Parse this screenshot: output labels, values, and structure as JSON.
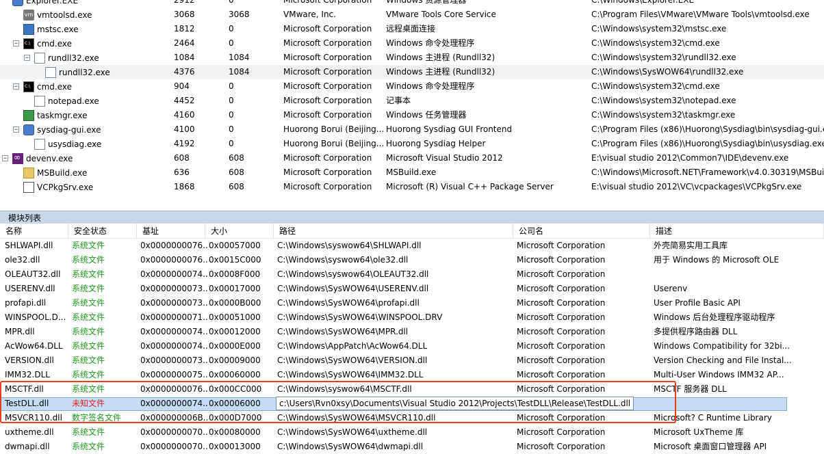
{
  "processes": [
    {
      "indent": 0,
      "toggle": "",
      "icon": "hr",
      "name": "Explorer.EXE",
      "pid": "2912",
      "ppid": "0",
      "company": "Microsoft Corporation",
      "desc": "Windows 资源管理器",
      "path": "C:\\Windows\\Explorer.EXE",
      "icon_name": "explorer-icon"
    },
    {
      "indent": 1,
      "toggle": "",
      "icon": "vm",
      "name": "vmtoolsd.exe",
      "pid": "3068",
      "ppid": "3068",
      "company": "VMware, Inc.",
      "desc": "VMware Tools Core Service",
      "path": "C:\\Program Files\\VMware\\VMware Tools\\vmtoolsd.exe",
      "icon_name": "vmware-icon"
    },
    {
      "indent": 1,
      "toggle": "",
      "icon": "rdp",
      "name": "mstsc.exe",
      "pid": "1812",
      "ppid": "0",
      "company": "Microsoft Corporation",
      "desc": "远程桌面连接",
      "path": "C:\\Windows\\system32\\mstsc.exe",
      "icon_name": "remote-desktop-icon"
    },
    {
      "indent": 1,
      "toggle": "⊟",
      "icon": "cmd",
      "name": "cmd.exe",
      "pid": "2464",
      "ppid": "0",
      "company": "Microsoft Corporation",
      "desc": "Windows 命令处理程序",
      "path": "C:\\Windows\\system32\\cmd.exe",
      "icon_name": "cmd-icon"
    },
    {
      "indent": 2,
      "toggle": "⊟",
      "icon": "doc",
      "name": "rundll32.exe",
      "pid": "1084",
      "ppid": "1084",
      "company": "Microsoft Corporation",
      "desc": "Windows 主进程 (Rundll32)",
      "path": "C:\\Windows\\system32\\rundll32.exe",
      "icon_name": "document-icon"
    },
    {
      "indent": 3,
      "toggle": "",
      "icon": "doc",
      "name": "rundll32.exe",
      "pid": "4376",
      "ppid": "1084",
      "company": "Microsoft Corporation",
      "desc": "Windows 主进程 (Rundll32)",
      "path": "C:\\Windows\\SysWOW64\\rundll32.exe",
      "icon_name": "document-icon",
      "selected": true
    },
    {
      "indent": 1,
      "toggle": "⊟",
      "icon": "cmd",
      "name": "cmd.exe",
      "pid": "904",
      "ppid": "0",
      "company": "Microsoft Corporation",
      "desc": "Windows 命令处理程序",
      "path": "C:\\Windows\\system32\\cmd.exe",
      "icon_name": "cmd-icon"
    },
    {
      "indent": 2,
      "toggle": "",
      "icon": "doc",
      "name": "notepad.exe",
      "pid": "4452",
      "ppid": "0",
      "company": "Microsoft Corporation",
      "desc": "记事本",
      "path": "C:\\Windows\\system32\\notepad.exe",
      "icon_name": "notepad-icon"
    },
    {
      "indent": 1,
      "toggle": "",
      "icon": "task",
      "name": "taskmgr.exe",
      "pid": "4160",
      "ppid": "0",
      "company": "Microsoft Corporation",
      "desc": "Windows 任务管理器",
      "path": "C:\\Windows\\system32\\taskmgr.exe",
      "icon_name": "task-manager-icon"
    },
    {
      "indent": 1,
      "toggle": "⊟",
      "icon": "hr",
      "name": "sysdiag-gui.exe",
      "pid": "4100",
      "ppid": "0",
      "company": "Huorong Borui (Beijing...",
      "desc": "Huorong Sysdiag GUI Frontend",
      "path": "C:\\Program Files (x86)\\Huorong\\Sysdiag\\bin\\sysdiag-gui.e",
      "icon_name": "huorong-icon"
    },
    {
      "indent": 2,
      "toggle": "",
      "icon": "doc",
      "name": "usysdiag.exe",
      "pid": "4192",
      "ppid": "0",
      "company": "Huorong Borui (Beijing...",
      "desc": "Huorong Sysdiag Helper",
      "path": "C:\\Program Files (x86)\\Huorong\\Sysdiag\\bin\\usysdiag.exe",
      "icon_name": "document-icon"
    },
    {
      "indent": 0,
      "toggle": "⊟",
      "icon": "vs",
      "name": "devenv.exe",
      "pid": "608",
      "ppid": "608",
      "company": "Microsoft Corporation",
      "desc": "Microsoft Visual Studio 2012",
      "path": "E:\\visual studio 2012\\Common7\\IDE\\devenv.exe",
      "icon_name": "visual-studio-icon"
    },
    {
      "indent": 1,
      "toggle": "",
      "icon": "ms",
      "name": "MSBuild.exe",
      "pid": "636",
      "ppid": "608",
      "company": "Microsoft Corporation",
      "desc": "MSBuild.exe",
      "path": "C:\\Windows\\Microsoft.NET\\Framework\\v4.0.30319\\MSBuil",
      "icon_name": "msbuild-icon"
    },
    {
      "indent": 1,
      "toggle": "",
      "icon": "vc",
      "name": "VCPkgSrv.exe",
      "pid": "1868",
      "ppid": "608",
      "company": "Microsoft Corporation",
      "desc": "Microsoft (R) Visual C++ Package Server",
      "path": "E:\\visual studio 2012\\VC\\vcpackages\\VCPkgSrv.exe",
      "icon_name": "vcpkgsrv-icon"
    }
  ],
  "module_panel": {
    "title": "模块列表",
    "columns": [
      "名称",
      "安全状态",
      "基址",
      "大小",
      "路径",
      "公司名",
      "描述"
    ]
  },
  "modules": [
    {
      "name": "SHLWAPI.dll",
      "status": "系统文件",
      "status_type": "sys",
      "base": "0x0000000076...",
      "size": "0x00057000",
      "path": "C:\\Windows\\syswow64\\SHLWAPI.dll",
      "company": "Microsoft Corporation",
      "desc": "外壳简易实用工具库"
    },
    {
      "name": "ole32.dll",
      "status": "系统文件",
      "status_type": "sys",
      "base": "0x0000000076...",
      "size": "0x0015C000",
      "path": "C:\\Windows\\syswow64\\ole32.dll",
      "company": "Microsoft Corporation",
      "desc": "用于 Windows 的 Microsoft OLE"
    },
    {
      "name": "OLEAUT32.dll",
      "status": "系统文件",
      "status_type": "sys",
      "base": "0x0000000074...",
      "size": "0x0008F000",
      "path": "C:\\Windows\\syswow64\\OLEAUT32.dll",
      "company": "Microsoft Corporation",
      "desc": ""
    },
    {
      "name": "USERENV.dll",
      "status": "系统文件",
      "status_type": "sys",
      "base": "0x0000000073...",
      "size": "0x00017000",
      "path": "C:\\Windows\\SysWOW64\\USERENV.dll",
      "company": "Microsoft Corporation",
      "desc": "Userenv"
    },
    {
      "name": "profapi.dll",
      "status": "系统文件",
      "status_type": "sys",
      "base": "0x0000000073...",
      "size": "0x0000B000",
      "path": "C:\\Windows\\SysWOW64\\profapi.dll",
      "company": "Microsoft Corporation",
      "desc": "User Profile Basic API"
    },
    {
      "name": "WINSPOOL.D...",
      "status": "系统文件",
      "status_type": "sys",
      "base": "0x0000000071...",
      "size": "0x00051000",
      "path": "C:\\Windows\\SysWOW64\\WINSPOOL.DRV",
      "company": "Microsoft Corporation",
      "desc": "Windows 后台处理程序驱动程序"
    },
    {
      "name": "MPR.dll",
      "status": "系统文件",
      "status_type": "sys",
      "base": "0x0000000074...",
      "size": "0x00012000",
      "path": "C:\\Windows\\SysWOW64\\MPR.dll",
      "company": "Microsoft Corporation",
      "desc": "多提供程序路由器 DLL"
    },
    {
      "name": "AcWow64.DLL",
      "status": "系统文件",
      "status_type": "sys",
      "base": "0x0000000074...",
      "size": "0x0000E000",
      "path": "C:\\Windows\\AppPatch\\AcWow64.DLL",
      "company": "Microsoft Corporation",
      "desc": "Windows Compatibility for 32bi..."
    },
    {
      "name": "VERSION.dll",
      "status": "系统文件",
      "status_type": "sys",
      "base": "0x0000000073...",
      "size": "0x00009000",
      "path": "C:\\Windows\\SysWOW64\\VERSION.dll",
      "company": "Microsoft Corporation",
      "desc": "Version Checking and File Instal..."
    },
    {
      "name": "IMM32.DLL",
      "status": "系统文件",
      "status_type": "sys",
      "base": "0x0000000075...",
      "size": "0x00060000",
      "path": "C:\\Windows\\SysWOW64\\IMM32.DLL",
      "company": "Microsoft Corporation",
      "desc": "Multi-User Windows IMM32 AP..."
    },
    {
      "name": "MSCTF.dll",
      "status": "系统文件",
      "status_type": "sys",
      "base": "0x0000000076...",
      "size": "0x000CC000",
      "path": "C:\\Windows\\syswow64\\MSCTF.dll",
      "company": "Microsoft Corporation",
      "desc": "MSCTF 服务器 DLL"
    },
    {
      "name": "TestDLL.dll",
      "status": "未知文件",
      "status_type": "unk",
      "base": "0x0000000074...",
      "size": "0x00006000",
      "path": "c:\\Users\\Rvn0xsy\\Documents\\Visual Studio 2012\\Projects\\TestDLL\\Release\\TestDLL.dll",
      "company": "",
      "desc": "",
      "selected": true
    },
    {
      "name": "MSVCR110.dll",
      "status": "数字签名文件",
      "status_type": "sig",
      "base": "0x000000006B...",
      "size": "0x000D7000",
      "path": "C:\\Windows\\SysWOW64\\MSVCR110.dll",
      "company": "Microsoft Corporation",
      "desc": "Microsoft? C Runtime Library"
    },
    {
      "name": "uxtheme.dll",
      "status": "系统文件",
      "status_type": "sys",
      "base": "0x0000000070...",
      "size": "0x00080000",
      "path": "C:\\Windows\\SysWOW64\\uxtheme.dll",
      "company": "Microsoft Corporation",
      "desc": "Microsoft UxTheme 库"
    },
    {
      "name": "dwmapi.dll",
      "status": "系统文件",
      "status_type": "sys",
      "base": "0x0000000070...",
      "size": "0x00013000",
      "path": "C:\\Windows\\SysWOW64\\dwmapi.dll",
      "company": "Microsoft Corporation",
      "desc": "Microsoft 桌面窗口管理器 API"
    }
  ]
}
